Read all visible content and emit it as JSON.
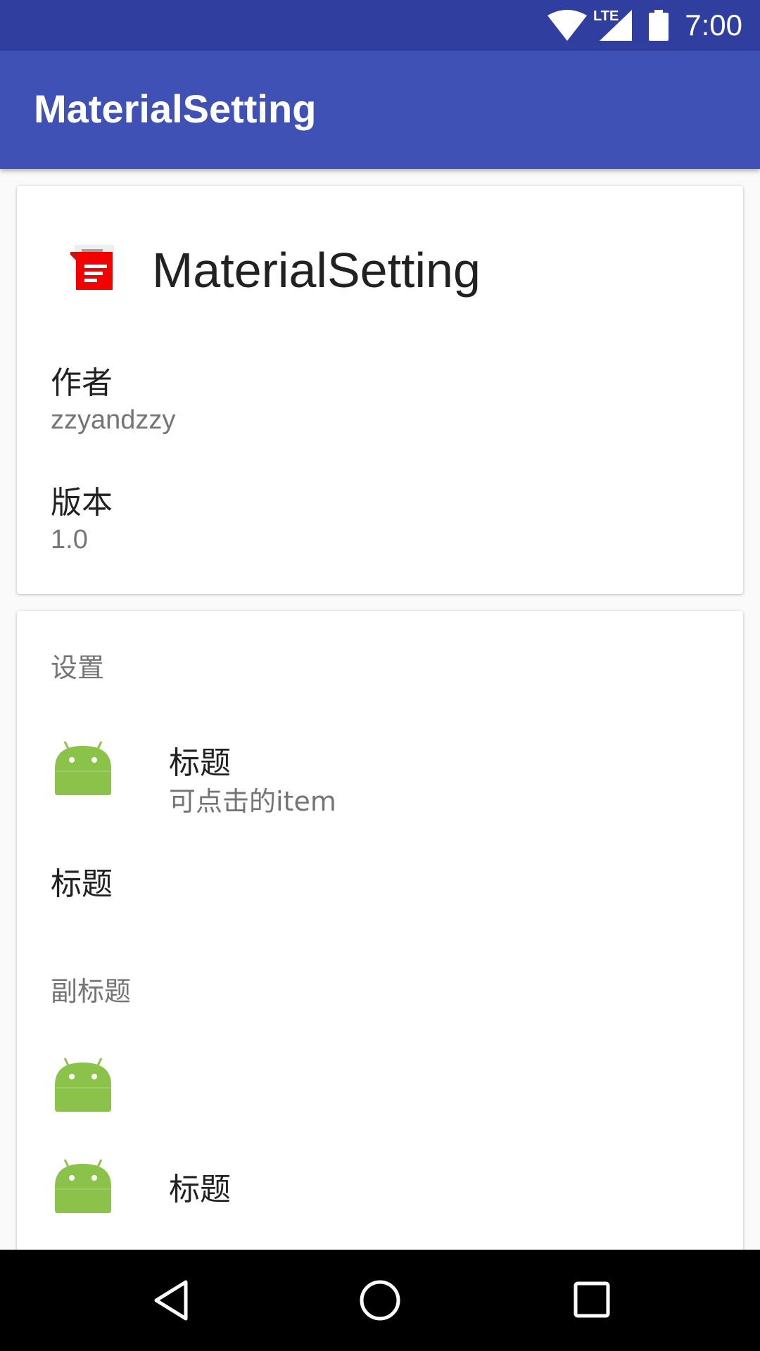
{
  "status_bar": {
    "time": "7:00",
    "network": "LTE"
  },
  "toolbar": {
    "title": "MaterialSetting"
  },
  "about_card": {
    "app_name": "MaterialSetting",
    "icon": "app-logo-icon",
    "author_label": "作者",
    "author_value": "zzyandzzy",
    "version_label": "版本",
    "version_value": "1.0"
  },
  "settings_card": {
    "header": "设置",
    "items": [
      {
        "icon": "android-icon",
        "title": "标题",
        "subtitle": "可点击的item"
      },
      {
        "title": "标题"
      }
    ],
    "subheader": "副标题",
    "items2": [
      {
        "icon": "android-icon"
      },
      {
        "icon": "android-icon",
        "title": "标题"
      }
    ]
  },
  "colors": {
    "primary": "#3f51b5",
    "primary_dark": "#303f9f",
    "android_green": "#8bc34a"
  }
}
